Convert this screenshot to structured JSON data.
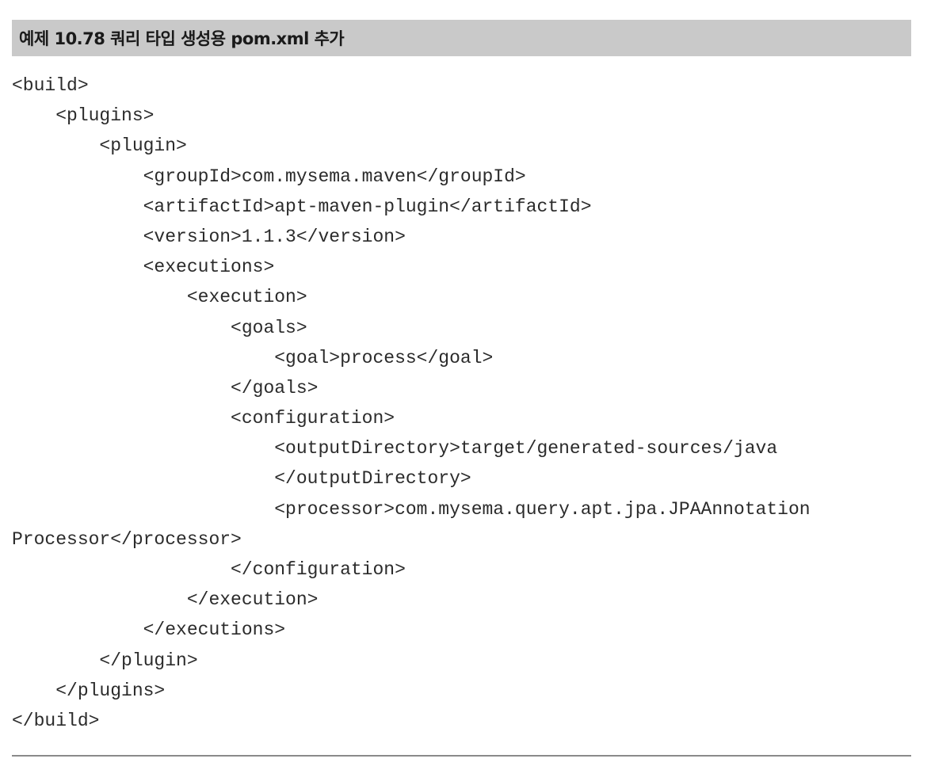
{
  "caption": "예제 10.78 쿼리 타입 생성용 pom.xml 추가",
  "code_lines": [
    "<build>",
    "    <plugins>",
    "        <plugin>",
    "            <groupId>com.mysema.maven</groupId>",
    "            <artifactId>apt-maven-plugin</artifactId>",
    "            <version>1.1.3</version>",
    "            <executions>",
    "                <execution>",
    "                    <goals>",
    "                        <goal>process</goal>",
    "                    </goals>",
    "                    <configuration>",
    "                        <outputDirectory>target/generated-sources/java",
    "                        </outputDirectory>",
    "                        <processor>com.mysema.query.apt.jpa.JPAAnnotation",
    "Processor</processor>",
    "                    </configuration>",
    "                </execution>",
    "            </executions>",
    "        </plugin>",
    "    </plugins>",
    "</build>"
  ]
}
